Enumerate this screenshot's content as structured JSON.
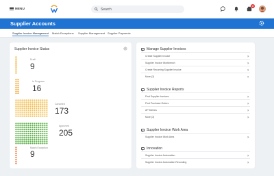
{
  "topbar": {
    "menu_label": "MENU",
    "search_placeholder": "Search",
    "notification_count": "3"
  },
  "header": {
    "title": "Supplier Accounts"
  },
  "tabs": [
    {
      "label": "Supplier Invoice Management",
      "active": true
    },
    {
      "label": "Match Exceptions",
      "active": false
    },
    {
      "label": "Supplier Management",
      "active": false
    },
    {
      "label": "Supplier Payments",
      "active": false
    }
  ],
  "status_card": {
    "title": "Supplier Invoice Status",
    "statuses": [
      {
        "label": "Draft",
        "count": "9",
        "color": "#f0b33a"
      },
      {
        "label": "In Progress",
        "count": "16",
        "color": "#f0a830"
      },
      {
        "label": "Canceled",
        "count": "173",
        "color": "#f2c057"
      },
      {
        "label": "Approved",
        "count": "205",
        "color": "#5db04a"
      },
      {
        "label": "Match Exception",
        "count": "9",
        "color": "#e8773a"
      }
    ]
  },
  "actions_card": {
    "sections": [
      {
        "title": "Manage Supplier Invoices",
        "items": [
          "Create Supplier Invoice",
          "Supplier Invoice Workbench",
          "Create Recurring Supplier Invoice",
          "More (2)"
        ]
      },
      {
        "title": "Supplier Invoice Reports",
        "items": [
          "Find Supplier Invoices",
          "Find Purchase Orders",
          "AP Metrics",
          "More (3)"
        ]
      },
      {
        "title": "Supplier Invoice Work Area",
        "items": [
          "Supplier Invoice Work Area"
        ]
      },
      {
        "title": "Innovation",
        "items": [
          "Supplier Invoice Automation",
          "Supplier Invoice Automation Recording"
        ]
      }
    ]
  },
  "colors": {
    "brand_blue": "#1e73d3",
    "badge_red": "#e03b3b"
  }
}
